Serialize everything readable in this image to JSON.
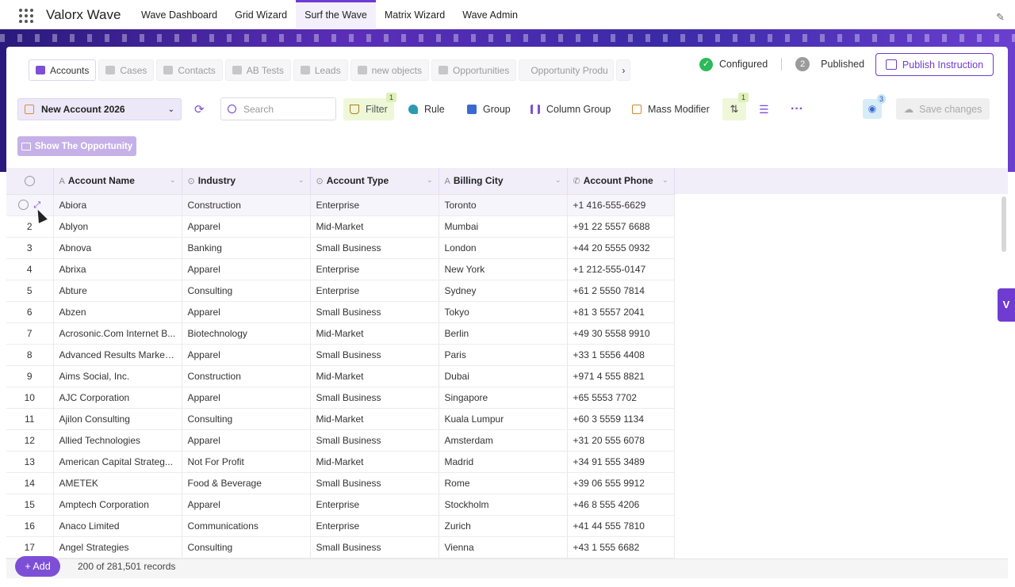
{
  "app": {
    "name": "Valorx Wave",
    "nav_tabs": [
      "Wave Dashboard",
      "Grid Wizard",
      "Surf the Wave",
      "Matrix Wizard",
      "Wave Admin"
    ]
  },
  "object_tabs": [
    "Accounts",
    "Cases",
    "Contacts",
    "AB Tests",
    "Leads",
    "new objects",
    "Opportunities",
    "Opportunity Produ"
  ],
  "more_tabs_icon": "chevron-right",
  "status": {
    "configured_label": "Configured",
    "published_count": "2",
    "published_label": "Published",
    "publish_button": "Publish Instruction"
  },
  "toolbar": {
    "view_name": "New Account 2026",
    "search_placeholder": "Search",
    "filter_label": "Filter",
    "filter_badge": "1",
    "rule_label": "Rule",
    "group_label": "Group",
    "column_group_label": "Column Group",
    "mass_modifier_label": "Mass Modifier",
    "sort_badge": "1",
    "hidden_badge": "3",
    "save_label": "Save changes",
    "show_opportunity_label": "Show The Opportunity"
  },
  "grid": {
    "columns": [
      "Account Name",
      "Industry",
      "Account Type",
      "Billing City",
      "Account Phone"
    ],
    "rows": [
      {
        "idx": "",
        "name": "Abiora",
        "industry": "Construction",
        "type": "Enterprise",
        "city": "Toronto",
        "phone": "+1 416-555-6629"
      },
      {
        "idx": "2",
        "name": "Ablyon",
        "industry": "Apparel",
        "type": "Mid-Market",
        "city": "Mumbai",
        "phone": "+91 22 5557 6688"
      },
      {
        "idx": "3",
        "name": "Abnova",
        "industry": "Banking",
        "type": "Small Business",
        "city": "London",
        "phone": "+44 20 5555 0932"
      },
      {
        "idx": "4",
        "name": "Abrixa",
        "industry": "Apparel",
        "type": "Enterprise",
        "city": "New York",
        "phone": "+1 212-555-0147"
      },
      {
        "idx": "5",
        "name": "Abture",
        "industry": "Consulting",
        "type": "Enterprise",
        "city": "Sydney",
        "phone": "+61 2 5550 7814"
      },
      {
        "idx": "6",
        "name": "Abzen",
        "industry": "Apparel",
        "type": "Small Business",
        "city": "Tokyo",
        "phone": "+81 3 5557 2041"
      },
      {
        "idx": "7",
        "name": "Acrosonic.Com Internet B...",
        "industry": "Biotechnology",
        "type": "Mid-Market",
        "city": "Berlin",
        "phone": "+49 30 5558 9910"
      },
      {
        "idx": "8",
        "name": "Advanced Results Marketi...",
        "industry": "Apparel",
        "type": "Small Business",
        "city": "Paris",
        "phone": "+33 1 5556 4408"
      },
      {
        "idx": "9",
        "name": "Aims Social, Inc.",
        "industry": "Construction",
        "type": "Mid-Market",
        "city": "Dubai",
        "phone": "+971 4 555 8821"
      },
      {
        "idx": "10",
        "name": "AJC Corporation",
        "industry": "Apparel",
        "type": "Small Business",
        "city": "Singapore",
        "phone": "+65 5553 7702"
      },
      {
        "idx": "11",
        "name": "Ajilon Consulting",
        "industry": "Consulting",
        "type": "Mid-Market",
        "city": "Kuala Lumpur",
        "phone": "+60 3 5559 1134"
      },
      {
        "idx": "12",
        "name": "Allied Technologies",
        "industry": "Apparel",
        "type": "Small Business",
        "city": "Amsterdam",
        "phone": "+31 20 555 6078"
      },
      {
        "idx": "13",
        "name": "American Capital Strateg...",
        "industry": "Not For Profit",
        "type": "Mid-Market",
        "city": "Madrid",
        "phone": "+34 91 555 3489"
      },
      {
        "idx": "14",
        "name": "AMETEK",
        "industry": "Food & Beverage",
        "type": "Small Business",
        "city": "Rome",
        "phone": "+39 06 555 9912"
      },
      {
        "idx": "15",
        "name": "Amptech Corporation",
        "industry": "Apparel",
        "type": "Enterprise",
        "city": "Stockholm",
        "phone": "+46 8 555 4206"
      },
      {
        "idx": "16",
        "name": "Anaco Limited",
        "industry": "Communications",
        "type": "Enterprise",
        "city": "Zurich",
        "phone": "+41 44 555 7810"
      },
      {
        "idx": "17",
        "name": "Angel Strategies",
        "industry": "Consulting",
        "type": "Small Business",
        "city": "Vienna",
        "phone": "+43 1 555 6682"
      }
    ]
  },
  "footer": {
    "add_label": "+ Add",
    "record_count": "200 of 281,501 records"
  }
}
